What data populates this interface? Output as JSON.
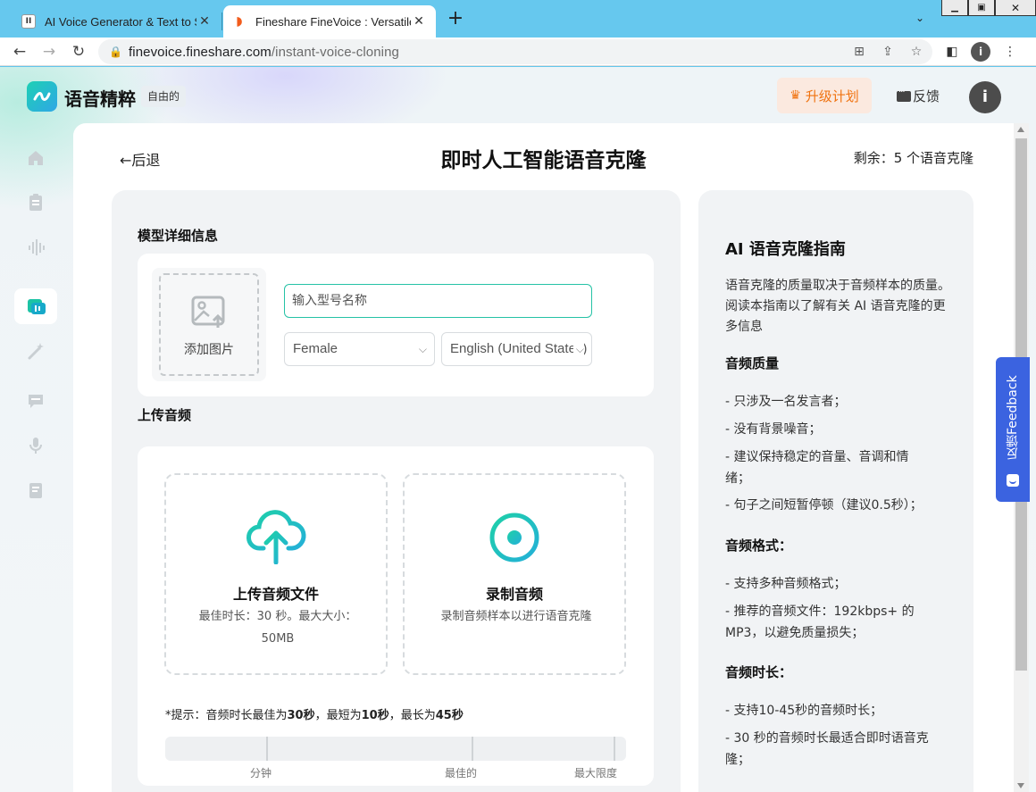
{
  "browser": {
    "tabs": [
      {
        "title": "AI Voice Generator & Text to Sp",
        "icon": "pause-icon"
      },
      {
        "title": "Fineshare FineVoice : Versatile",
        "icon": "fineshare-icon"
      }
    ],
    "new_tab": "+",
    "url_host": "finevoice.fineshare.com",
    "url_path": "/instant-voice-cloning",
    "profile_initial": "i"
  },
  "header": {
    "brand": "语音精粹",
    "badge": "自由的",
    "upgrade_label": "升级计划",
    "feedback_label": "反馈",
    "avatar_initial": "i"
  },
  "sidebar": {
    "items": [
      {
        "name": "home-icon"
      },
      {
        "name": "document-icon"
      },
      {
        "name": "waveform-icon"
      },
      {
        "name": "voice-clone-icon",
        "active": true
      },
      {
        "name": "magic-wand-icon"
      },
      {
        "name": "chat-icon"
      },
      {
        "name": "microphone-icon"
      },
      {
        "name": "notes-icon"
      }
    ]
  },
  "main": {
    "back_label": "←后退",
    "title": "即时人工智能语音克隆",
    "remaining": "剩余：5 个语音克隆",
    "model_section_title": "模型详细信息",
    "add_image_label": "添加图片",
    "name_placeholder": "输入型号名称",
    "gender_value": "Female",
    "language_value": "English (United States)",
    "upload_section_title": "上传音频",
    "upload_file_title": "上传音频文件",
    "upload_file_desc": "最佳时长：30 秒。最大大小：50MB",
    "record_title": "录制音频",
    "record_desc": "录制音频样本以进行语音克隆",
    "tip_prefix": "*提示：音频时长最佳为",
    "tip_best": "30秒",
    "tip_mid1": "，最短为",
    "tip_min": "10秒",
    "tip_mid2": "，最长为",
    "tip_max": "45秒",
    "bar_labels": {
      "min": "分钟",
      "best": "最佳的",
      "max": "最大限度"
    }
  },
  "guide": {
    "title": "AI 语音克隆指南",
    "intro": "语音克隆的质量取决于音频样本的质量。阅读本指南以了解有关 AI 语音克隆的更多信息",
    "quality_heading": "音频质量",
    "quality_items": [
      "- 只涉及一名发言者；",
      "- 没有背景噪音；",
      "- 建议保持稳定的音量、音调和情绪；",
      "- 句子之间短暂停顿（建议0.5秒）；"
    ],
    "format_heading": "音频格式：",
    "format_items": [
      "- 支持多种音频格式；",
      "- 推荐的音频文件：192kbps+ 的 MP3，以避免质量损失；"
    ],
    "duration_heading": "音频时长：",
    "duration_items": [
      "- 支持10-45秒的音频时长；",
      "- 30 秒的音频时长最适合即时语音克隆；"
    ]
  },
  "feedback_tab": {
    "label": "反馈Feedback"
  },
  "colors": {
    "accent": "#25c2a6",
    "upgrade": "#f0720f",
    "feedback_tab": "#3b63e0"
  }
}
